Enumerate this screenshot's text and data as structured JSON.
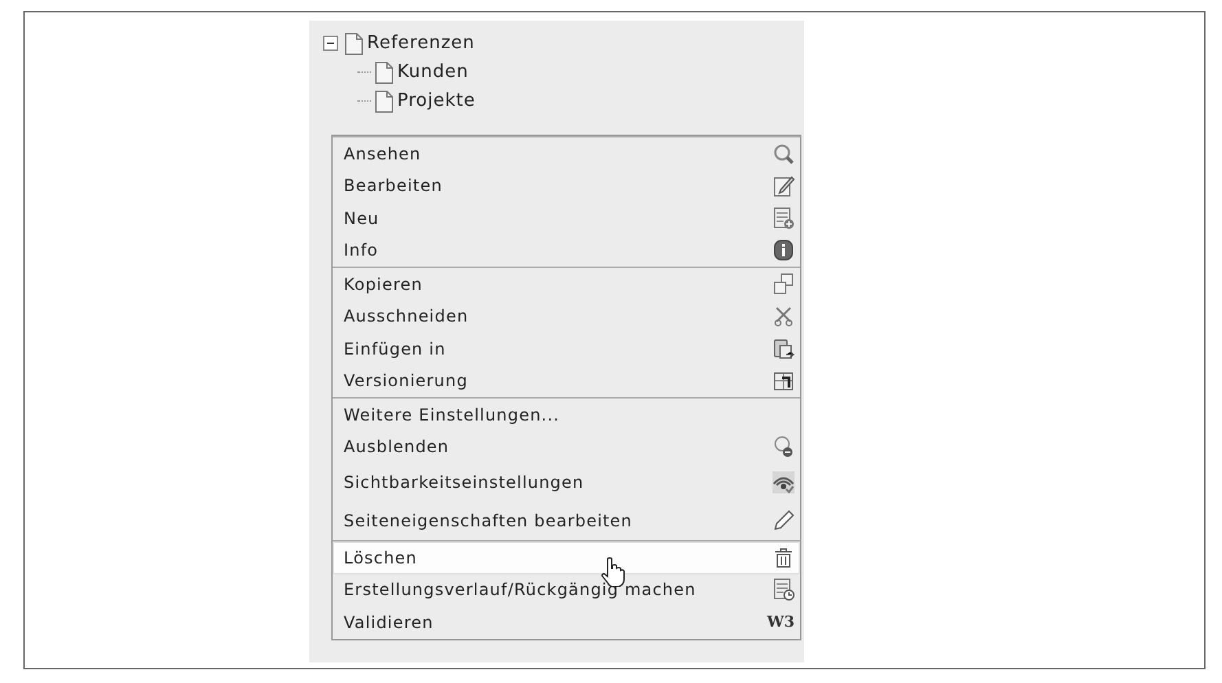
{
  "tree": {
    "items": [
      {
        "label": "Referenzen",
        "expanded": true,
        "children": [
          {
            "label": "Kunden"
          },
          {
            "label": "Projekte"
          }
        ]
      }
    ]
  },
  "context_menu": {
    "groups": [
      [
        {
          "label": "Ansehen",
          "kind": "search",
          "hovered": false
        },
        {
          "label": "Bearbeiten",
          "kind": "page-pencil",
          "hovered": false
        },
        {
          "label": "Neu",
          "kind": "page-plus",
          "hovered": false
        },
        {
          "label": "Info",
          "kind": "info",
          "hovered": false
        }
      ],
      [
        {
          "label": "Kopieren",
          "kind": "copy",
          "hovered": false
        },
        {
          "label": "Ausschneiden",
          "kind": "scissors",
          "hovered": false
        },
        {
          "label": "Einfügen in",
          "kind": "paste",
          "hovered": false
        },
        {
          "label": "Versionierung",
          "kind": "page-arrow",
          "hovered": false
        }
      ],
      [
        {
          "label": "Weitere Einstellungen...",
          "kind": "plain",
          "hovered": false
        },
        {
          "label": "Ausblenden",
          "kind": "bubble-minus",
          "hovered": false
        },
        {
          "label": "Sichtbarkeitseinstellungen",
          "kind": "eye-check",
          "hovered": false
        },
        {
          "label": "Seiteneigenschaften bearbeiten",
          "kind": "pencil",
          "hovered": false
        }
      ],
      [
        {
          "label": "Löschen",
          "kind": "trash",
          "hovered": true
        },
        {
          "label": "Erstellungsverlauf/Rückgängig machen",
          "kind": "page-clock",
          "hovered": false
        },
        {
          "label": "Validieren",
          "kind": "badge",
          "badge": "W3",
          "hovered": false
        }
      ]
    ]
  }
}
